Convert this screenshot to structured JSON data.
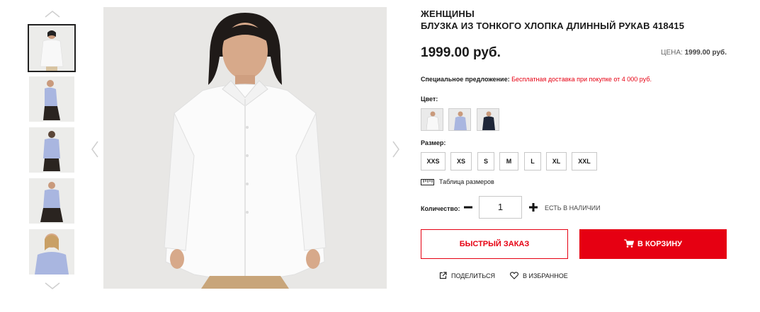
{
  "product": {
    "category": "ЖЕНЩИНЫ",
    "title": "БЛУЗКА ИЗ ТОНКОГО ХЛОПКА ДЛИННЫЙ РУКАВ 418415",
    "price": "1999.00 руб.",
    "price_label": "ЦЕНА:",
    "price_value": "1999.00 руб."
  },
  "promo": {
    "label": "Специальное предложение:",
    "text": "Бесплатная доставка при покупке от 4 000 руб."
  },
  "color": {
    "label": "Цвет:",
    "swatches": [
      {
        "name": "white",
        "color": "#f4f4f4"
      },
      {
        "name": "light-blue",
        "color": "#a9b6e0"
      },
      {
        "name": "navy",
        "color": "#1e2638"
      }
    ]
  },
  "size": {
    "label": "Размер:",
    "options": [
      "XXS",
      "XS",
      "S",
      "M",
      "L",
      "XL",
      "XXL"
    ]
  },
  "size_chart": {
    "label": "Таблица размеров",
    "icon": "ruler-icon"
  },
  "quantity": {
    "label": "Количество:",
    "value": "1",
    "stock": "ЕСТЬ В НАЛИЧИИ"
  },
  "actions": {
    "quick_order": "БЫСТРЫЙ ЗАКАЗ",
    "add_to_cart": "В КОРЗИНУ",
    "share": "ПОДЕЛИТЬСЯ",
    "favorite": "В ИЗБРАННОЕ"
  },
  "gallery": {
    "thumbnails": [
      {
        "shirt": "#f6f6f6",
        "pants": "#e8e8e8",
        "active": true
      },
      {
        "shirt": "#a9b6e0",
        "pants": "#2a2420",
        "active": false
      },
      {
        "shirt": "#a9b6e0",
        "pants": "#2a2420",
        "active": false
      },
      {
        "shirt": "#a9b6e0",
        "pants": "#2a2420",
        "active": false
      },
      {
        "shirt": "#a9b6e0",
        "pants": "#e6e6e6",
        "active": false
      }
    ]
  },
  "colors": {
    "accent": "#e60012",
    "text": "#1a1a1a",
    "border": "#c8c8c8"
  }
}
